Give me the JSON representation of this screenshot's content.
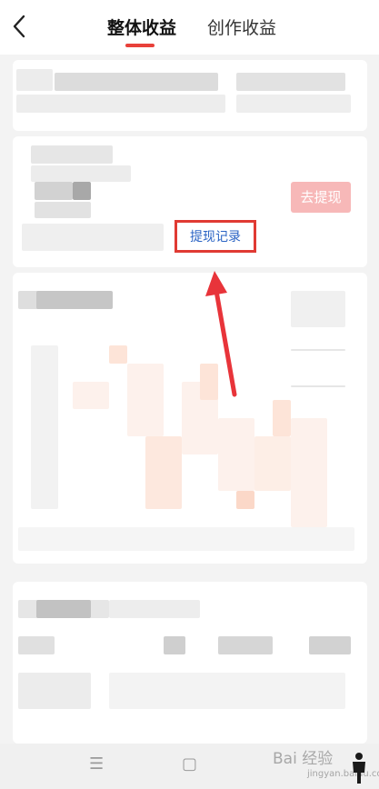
{
  "header": {
    "tabs": [
      {
        "label": "整体收益",
        "active": true
      },
      {
        "label": "创作收益",
        "active": false
      }
    ]
  },
  "account": {
    "withdraw_label": "去提现",
    "record_label": "提现记录"
  },
  "watermark": {
    "text": "Bai 经验",
    "sub": "jingyan.baidu.com"
  },
  "colors": {
    "accent": "#e8413a",
    "link": "#2a63c4",
    "withdraw_bg": "#f7b8b8"
  }
}
